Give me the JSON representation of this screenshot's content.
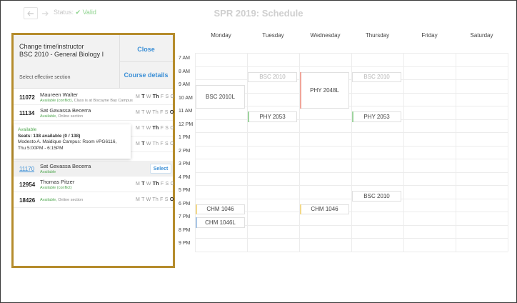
{
  "topbar": {
    "back_icon": "back-arrow-icon",
    "forward_icon": "forward-arrow-icon",
    "status_label": "Status:",
    "status_value": "Valid",
    "title": "SPR 2019: Schedule"
  },
  "calendar": {
    "days": [
      "Monday",
      "Tuesday",
      "Wednesday",
      "Thursday",
      "Friday",
      "Saturday"
    ],
    "times": [
      "7 AM",
      "8 AM",
      "9 AM",
      "10 AM",
      "11 AM",
      "12 PM",
      "1 PM",
      "2 PM",
      "3 PM",
      "4 PM",
      "5 PM",
      "6 PM",
      "7 PM",
      "8 PM",
      "9 PM"
    ],
    "events": [
      {
        "day": "Monday",
        "label": "BSC 2010L",
        "start": "9 AM",
        "end": "11 AM",
        "faded": false,
        "accent": ""
      },
      {
        "day": "Tuesday",
        "label": "BSC 2010",
        "start": "8 AM",
        "end": "9 AM",
        "faded": true,
        "accent": ""
      },
      {
        "day": "Wednesday",
        "label": "PHY 2048L",
        "start": "8 AM",
        "end": "11 AM",
        "faded": false,
        "accent": "#f0a59a"
      },
      {
        "day": "Thursday",
        "label": "BSC 2010",
        "start": "8 AM",
        "end": "9 AM",
        "faded": true,
        "accent": ""
      },
      {
        "day": "Tuesday",
        "label": "PHY 2053",
        "start": "11 AM",
        "end": "12 PM",
        "faded": false,
        "accent": "#9ed49e"
      },
      {
        "day": "Thursday",
        "label": "PHY 2053",
        "start": "11 AM",
        "end": "12 PM",
        "faded": false,
        "accent": "#9ed49e"
      },
      {
        "day": "Thursday",
        "label": "BSC 2010",
        "start": "5 PM",
        "end": "6 PM",
        "faded": false,
        "accent": ""
      },
      {
        "day": "Monday",
        "label": "CHM 1046",
        "start": "6 PM",
        "end": "7 PM",
        "faded": false,
        "accent": "#f2d889"
      },
      {
        "day": "Wednesday",
        "label": "CHM 1046",
        "start": "6 PM",
        "end": "7 PM",
        "faded": false,
        "accent": "#f2d889"
      },
      {
        "day": "Monday",
        "label": "CHM 1046L",
        "start": "7 PM",
        "end": "8 PM",
        "faded": false,
        "accent": "#a9c6e6"
      }
    ]
  },
  "panel": {
    "title_line1": "Change time/instructor",
    "title_line2": "BSC 2010 - General Biology I",
    "close_label": "Close",
    "course_details_label": "Course details",
    "effective_label": "Select effective section",
    "sections": [
      {
        "crn": "11072",
        "instructor": "Maureen Walter",
        "availability": "Available (conflict),",
        "extra": "Class is at Biscayne Bay Campus",
        "link": false,
        "days": [
          [
            "M",
            false
          ],
          [
            "T",
            true
          ],
          [
            "W",
            false
          ],
          [
            "Th",
            true
          ],
          [
            "F",
            false
          ],
          [
            "S",
            false
          ],
          [
            "O",
            false
          ]
        ]
      },
      {
        "crn": "11134",
        "instructor": "Sat Gavassa Becerra",
        "availability": "Available,",
        "extra": "Online section",
        "link": false,
        "days": [
          [
            "M",
            false
          ],
          [
            "T",
            false
          ],
          [
            "W",
            false
          ],
          [
            "Th",
            false
          ],
          [
            "F",
            false
          ],
          [
            "S",
            false
          ],
          [
            "O",
            true
          ]
        ]
      },
      {
        "crn": "",
        "instructor": "",
        "availability": "",
        "extra": "",
        "link": false,
        "days": [
          [
            "M",
            false
          ],
          [
            "T",
            false
          ],
          [
            "W",
            false
          ],
          [
            "Th",
            true
          ],
          [
            "F",
            false
          ],
          [
            "S",
            false
          ],
          [
            "O",
            false
          ]
        ]
      },
      {
        "crn": "",
        "instructor": "",
        "availability": "",
        "extra": "",
        "link": false,
        "days": [
          [
            "M",
            false
          ],
          [
            "T",
            true
          ],
          [
            "W",
            false
          ],
          [
            "Th",
            false
          ],
          [
            "F",
            false
          ],
          [
            "S",
            false
          ],
          [
            "O",
            false
          ]
        ]
      },
      {
        "crn": "11170",
        "instructor": "Sat Gavassa Becerra",
        "availability": "Available",
        "extra": "",
        "link": true,
        "selected": true,
        "days": []
      },
      {
        "crn": "12954",
        "instructor": "Thomas Pitzer",
        "availability": "Available (conflict)",
        "extra": "",
        "link": false,
        "days": [
          [
            "M",
            false
          ],
          [
            "T",
            true
          ],
          [
            "W",
            false
          ],
          [
            "Th",
            true
          ],
          [
            "F",
            false
          ],
          [
            "S",
            false
          ],
          [
            "O",
            false
          ]
        ]
      },
      {
        "crn": "18426",
        "instructor": "",
        "availability": "Available,",
        "extra": "Online section",
        "link": false,
        "days": [
          [
            "M",
            false
          ],
          [
            "T",
            false
          ],
          [
            "W",
            false
          ],
          [
            "Th",
            false
          ],
          [
            "F",
            false
          ],
          [
            "S",
            false
          ],
          [
            "O",
            true
          ]
        ]
      }
    ],
    "select_label": "Select",
    "tooltip": {
      "line1": "Available",
      "line2": "Seats: 138 available (0 / 138)",
      "line3": "Modesto A. Maidique Campus: Room #PG6116,",
      "line4": "Thu 5:00PM - 6:15PM"
    }
  }
}
